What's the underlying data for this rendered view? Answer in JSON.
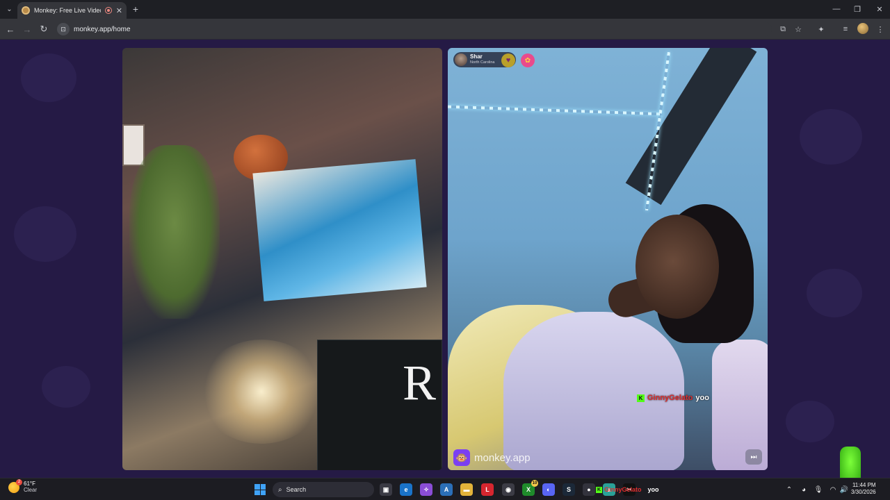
{
  "browser": {
    "tab": {
      "title": "Monkey: Free Live Video Ch"
    },
    "url": "monkey.app/home"
  },
  "stranger": {
    "name": "Shar",
    "location": "North Carolina"
  },
  "chat_overlay": {
    "username": "GinnyGelato",
    "message": "yoo",
    "platform_icon": "K"
  },
  "brand": {
    "name": "monkey.app"
  },
  "taskbar": {
    "weather": {
      "temp": "61°F",
      "desc": "Clear",
      "badge": "2"
    },
    "search_label": "Search",
    "overlay_user": "GinnyGelato",
    "overlay_msg": "yoo",
    "xbox_badge": "10",
    "clock": {
      "time": "11:44 PM",
      "date": "3/30/2026"
    }
  },
  "colors": {
    "page_bg": "#251a45",
    "accent_purple": "#7b3ff2",
    "kick_green": "#53fc18"
  }
}
